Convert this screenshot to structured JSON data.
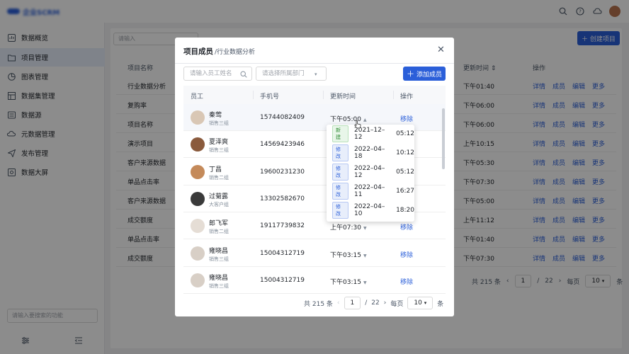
{
  "app": {
    "logo_text": "企业SCRM",
    "sidebar": {
      "items": [
        {
          "label": "数据概览",
          "icon": "dashboard-icon"
        },
        {
          "label": "项目管理",
          "icon": "folder-icon",
          "active": true
        },
        {
          "label": "图表管理",
          "icon": "pie-chart-icon"
        },
        {
          "label": "数据集管理",
          "icon": "dataset-icon"
        },
        {
          "label": "数据源",
          "icon": "datasource-icon"
        },
        {
          "label": "元数据管理",
          "icon": "metadata-icon"
        },
        {
          "label": "发布管理",
          "icon": "send-icon"
        },
        {
          "label": "数据大屏",
          "icon": "screen-icon"
        }
      ],
      "search_placeholder": "请输入要搜索的功能"
    },
    "main": {
      "search_placeholder": "请输入",
      "create_label": "创建项目",
      "col_name": "项目名称",
      "col_time": "更新时间",
      "col_ops": "操作",
      "rows": [
        {
          "name": "行业数据分析",
          "time": "下午01:40"
        },
        {
          "name": "复购率",
          "time": "下午06:00"
        },
        {
          "name": "项目名称",
          "time": "下午06:00"
        },
        {
          "name": "演示项目",
          "time": "上午10:15"
        },
        {
          "name": "客户来源数据",
          "time": "下午05:30"
        },
        {
          "name": "单品点击率",
          "time": "下午07:30"
        },
        {
          "name": "客户来源数据",
          "time": "下午05:00"
        },
        {
          "name": "成交额度",
          "time": "上午11:12"
        },
        {
          "name": "单品点击率",
          "time": "下午01:40"
        },
        {
          "name": "成交额度",
          "time": "下午07:30"
        }
      ],
      "ops": [
        "详情",
        "成员",
        "编辑",
        "更多"
      ],
      "pager": {
        "total": "共 215 条",
        "page": "1",
        "pages": "22",
        "per_label": "每页",
        "per": "10",
        "unit": "条"
      }
    }
  },
  "modal": {
    "title": "项目成员",
    "subtitle": "/行业数据分析",
    "search_placeholder": "请输入员工姓名",
    "dept_placeholder": "请选择所属部门",
    "add_label": "添加成员",
    "cols": {
      "employee": "员工",
      "phone": "手机号",
      "time": "更新时间",
      "ops": "操作"
    },
    "rows": [
      {
        "name": "秦莺",
        "dept": "销售三组",
        "phone": "15744082409",
        "time": "下午05:00",
        "op": "移除",
        "avatar": "#d9c7b5"
      },
      {
        "name": "夏泽爽",
        "dept": "销售三组",
        "phone": "14569423946",
        "time": "",
        "op": "",
        "avatar": "#8a5a3c"
      },
      {
        "name": "丁昌",
        "dept": "销售二组",
        "phone": "19600231230",
        "time": "",
        "op": "",
        "avatar": "#c48a5a"
      },
      {
        "name": "过菊露",
        "dept": "大客户组",
        "phone": "13302582670",
        "time": "",
        "op": "",
        "avatar": "#3a3a3a"
      },
      {
        "name": "郎飞军",
        "dept": "销售二组",
        "phone": "19117739832",
        "time": "上午07:30",
        "op": "移除",
        "avatar": "#e5ddd5"
      },
      {
        "name": "雍晓昌",
        "dept": "销售三组",
        "phone": "15004312719",
        "time": "下午03:15",
        "op": "移除",
        "avatar": "#d8cfc6"
      },
      {
        "name": "雍晓昌",
        "dept": "销售三组",
        "phone": "15004312719",
        "time": "下午03:15",
        "op": "移除",
        "avatar": "#d8cfc6"
      }
    ],
    "popover": [
      {
        "tag": "新建",
        "type": "new",
        "date": "2021–12–12",
        "time": "05:12"
      },
      {
        "tag": "修改",
        "type": "mod",
        "date": "2022–04–18",
        "time": "10:12"
      },
      {
        "tag": "修改",
        "type": "mod",
        "date": "2022–04–12",
        "time": "05:12"
      },
      {
        "tag": "修改",
        "type": "mod",
        "date": "2022–04–11",
        "time": "16:27"
      },
      {
        "tag": "修改",
        "type": "mod",
        "date": "2022–04–10",
        "time": "18:20"
      }
    ],
    "pager": {
      "total": "共 215 条",
      "page": "1",
      "pages": "22",
      "per_label": "每页",
      "per": "10",
      "unit": "条"
    }
  }
}
